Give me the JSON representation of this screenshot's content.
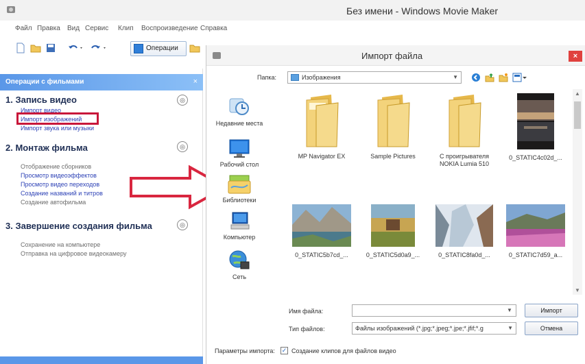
{
  "app": {
    "title": "Без имени - Windows Movie Maker",
    "menu": [
      "Файл",
      "Правка",
      "Вид",
      "Сервис",
      "Клип",
      "Воспроизведение",
      "Справка"
    ],
    "toolbar": {
      "operations_label": "Операции"
    }
  },
  "tasks": {
    "header": "Операции с фильмами",
    "sections": [
      {
        "title": "1. Запись видео",
        "toggle": "◎",
        "links": [
          "Импорт видео",
          "Импорт изображений",
          "Импорт звука или музыки"
        ]
      },
      {
        "title": "2. Монтаж фильма",
        "toggle": "◎",
        "links": [
          "Отображение сборников",
          "Просмотр видеоэффектов",
          "Просмотр видео переходов",
          "Создание названий и титров",
          "Создание автофильма"
        ]
      },
      {
        "title": "3. Завершение создания фильма",
        "toggle": "◎",
        "links": [
          "Сохранение на компьютере",
          "Отправка на цифровое видеокамеру"
        ]
      }
    ]
  },
  "dialog": {
    "title": "Импорт файла",
    "close": "×",
    "folder_label": "Папка:",
    "folder_value": "Изображения",
    "places": [
      "Недавние места",
      "Рабочий стол",
      "Библиотеки",
      "Компьютер",
      "Сеть"
    ],
    "files": [
      {
        "name": "MP Navigator EX",
        "kind": "folder"
      },
      {
        "name": "Sample Pictures",
        "kind": "folder"
      },
      {
        "name": "С проигрывателя NOKIA Lumia 510",
        "kind": "folder"
      },
      {
        "name": "0_STATIC4c02d_...",
        "kind": "photo-sunset"
      },
      {
        "name": "0_STATIC5b7cd_...",
        "kind": "photo-lake"
      },
      {
        "name": "0_STATIC5d0a9_...",
        "kind": "photo-autumn"
      },
      {
        "name": "0_STATIC8fa0d_...",
        "kind": "photo-winter"
      },
      {
        "name": "0_STATIC7d59_a...",
        "kind": "photo-flowers"
      }
    ],
    "filename_label": "Имя файла:",
    "filename_value": "",
    "filetype_label": "Тип файлов:",
    "filetype_value": "Файлы изображений (*.jpg;*.jpeg;*.jpe;*.jfif;*.g",
    "import_button": "Импорт",
    "cancel_button": "Отмена",
    "params_label": "Параметры импорта:",
    "params_checkbox": "Создание клипов для файлов видео",
    "params_checked": true
  },
  "colors": {
    "highlight": "#c8173a",
    "arrow": "#d9263f",
    "task_header": "#5a97e8",
    "link": "#2a3fb5"
  }
}
